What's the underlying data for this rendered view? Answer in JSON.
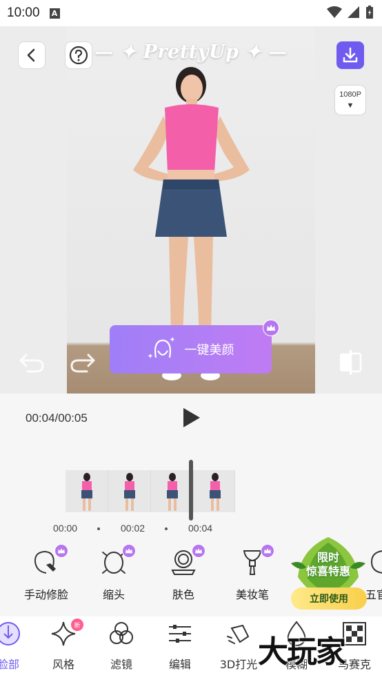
{
  "status_bar": {
    "time": "10:00",
    "notification_glyph": "A"
  },
  "preview": {
    "brand": "— ✦ PrettyUp ✦ —",
    "resolution": {
      "label": "1080P",
      "arrow": "▼"
    },
    "one_tap_beauty_label": "一键美颜"
  },
  "playback": {
    "current_time": "00:04",
    "total_time": "00:05",
    "time_separator": "/",
    "ticks": [
      "00:00",
      "00:02",
      "00:04"
    ]
  },
  "tools": [
    {
      "label": "手动修脸",
      "icon": "manual-face-icon",
      "premium": true
    },
    {
      "label": "缩头",
      "icon": "shrink-head-icon",
      "premium": true
    },
    {
      "label": "肤色",
      "icon": "skin-tone-icon",
      "premium": true
    },
    {
      "label": "美妆笔",
      "icon": "makeup-brush-icon",
      "premium": true
    },
    {
      "label": "五官",
      "icon": "features-icon",
      "premium": false
    }
  ],
  "promo": {
    "title_line1": "限时",
    "title_line2": "惊喜特惠",
    "button": "立即使用"
  },
  "nav": [
    {
      "label": "脸部",
      "icon": "face-icon",
      "active": true
    },
    {
      "label": "风格",
      "icon": "sparkle-icon",
      "badge": "新"
    },
    {
      "label": "滤镜",
      "icon": "filter-icon"
    },
    {
      "label": "编辑",
      "icon": "sliders-icon"
    },
    {
      "label": "3D打光",
      "icon": "lighting-icon"
    },
    {
      "label": "模糊",
      "icon": "blur-drop-icon"
    },
    {
      "label": "马赛克",
      "icon": "mosaic-icon"
    }
  ],
  "watermark": "大玩家",
  "colors": {
    "accent": "#6f5bf0",
    "beauty_button": "#b27ef5",
    "promo_button": "#f8cf4a",
    "new_badge": "#ff5d8f"
  }
}
